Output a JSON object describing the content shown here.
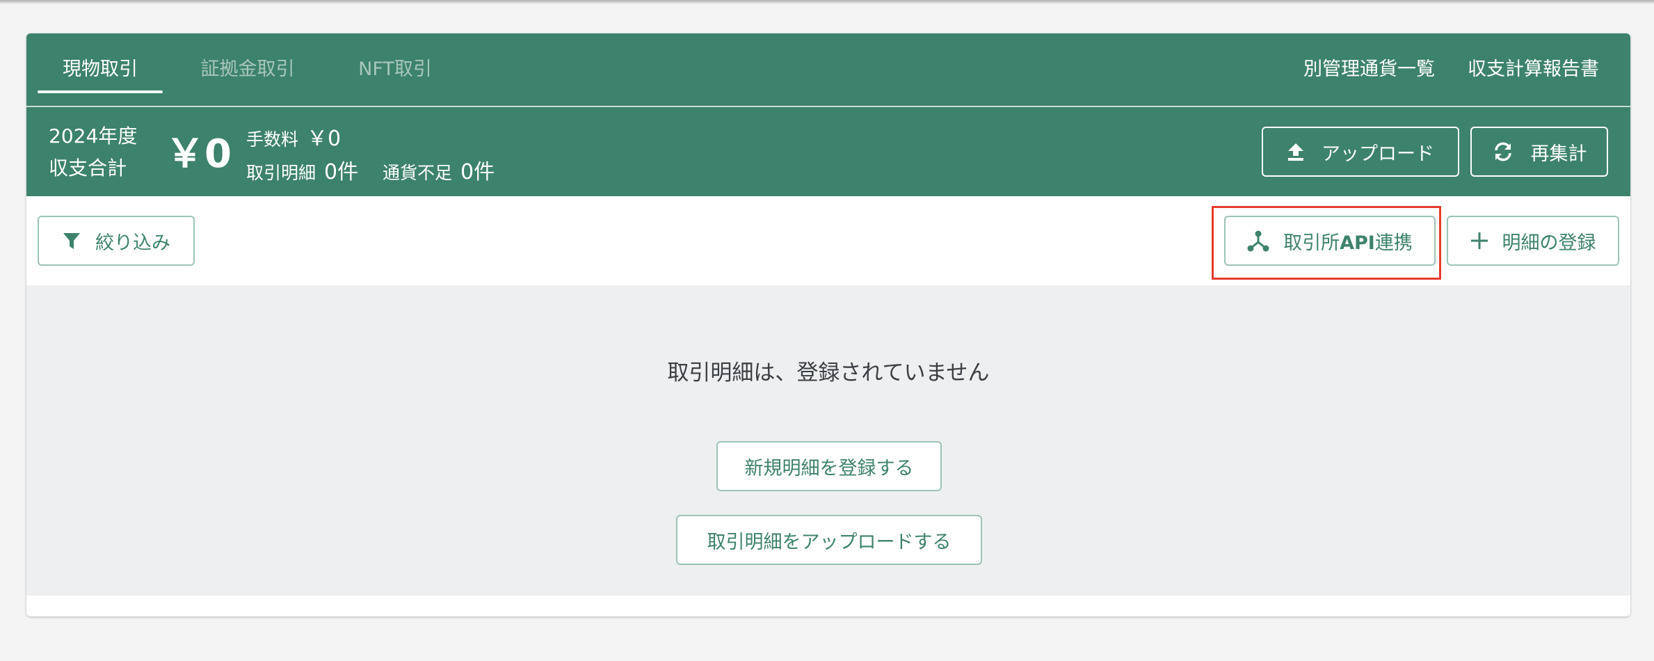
{
  "tabs": [
    {
      "label": "現物取引",
      "active": true
    },
    {
      "label": "証拠金取引",
      "active": false
    },
    {
      "label": "NFT取引",
      "active": false
    }
  ],
  "header_links": {
    "separate_currency_list": "別管理通貨一覧",
    "income_report": "収支計算報告書"
  },
  "summary": {
    "year": "2024年度",
    "total_label": "収支合計",
    "total_value": "￥0",
    "fee_label": "手数料",
    "fee_value": "￥0",
    "tx_detail_label": "取引明細",
    "tx_detail_count": "0件",
    "shortage_label": "通貨不足",
    "shortage_count": "0件"
  },
  "buttons": {
    "upload": "アップロード",
    "recalc": "再集計",
    "filter": "絞り込み",
    "api_prefix": "取引所",
    "api_bold": "API",
    "api_suffix": "連携",
    "register_detail": "明細の登録",
    "new_detail": "新規明細を登録する",
    "upload_detail": "取引明細をアップロードする"
  },
  "empty_state": {
    "message": "取引明細は、登録されていません"
  },
  "colors": {
    "brand": "#3d826c",
    "highlight": "#e63b2e",
    "empty_bg": "#eeeff0"
  },
  "icons": {
    "upload": "upload-icon",
    "recalc": "refresh-icon",
    "filter": "filter-icon",
    "api": "network-icon",
    "add": "plus-icon"
  }
}
